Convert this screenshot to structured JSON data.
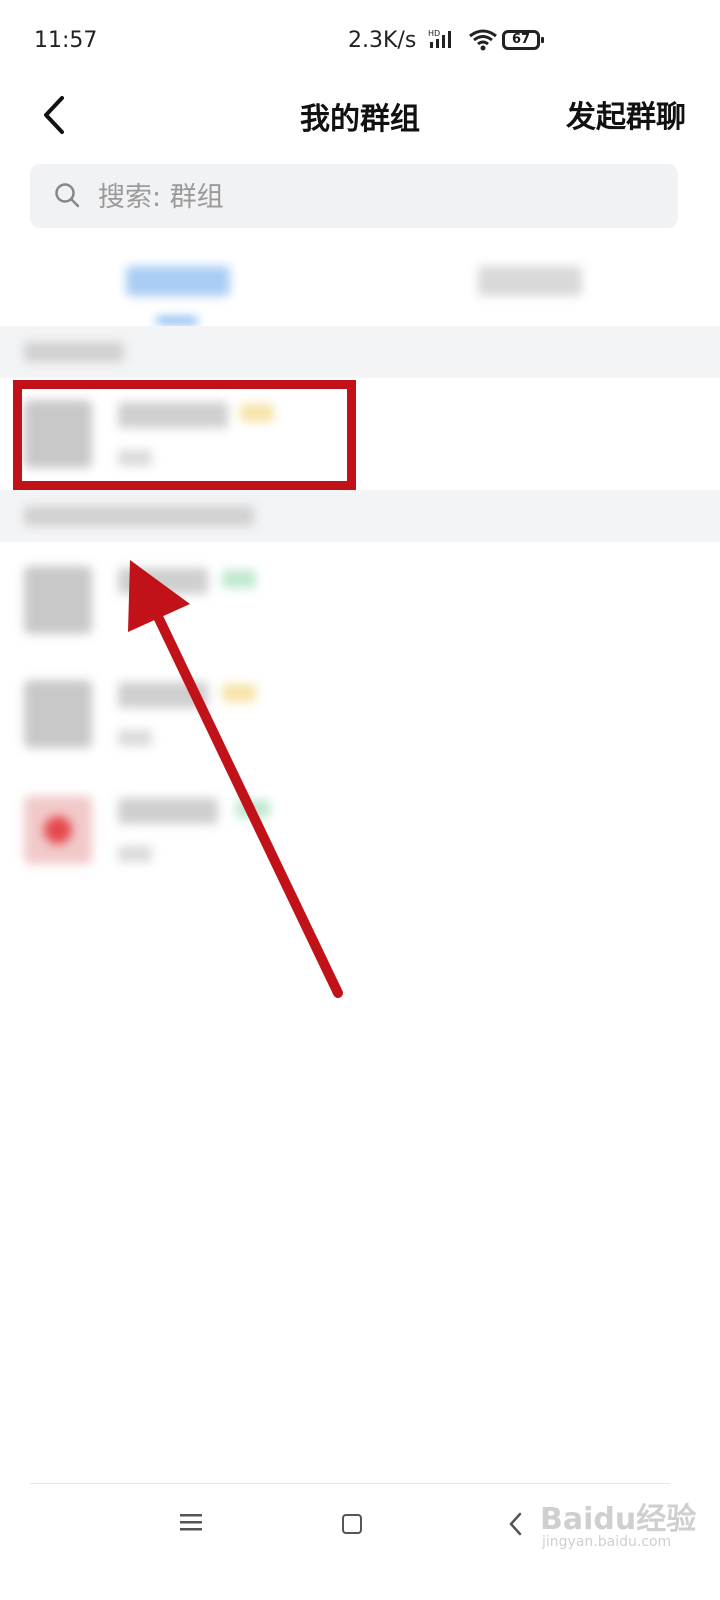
{
  "status": {
    "time": "11:57",
    "speed": "2.3K/s",
    "network_badge": "HD",
    "battery": "67"
  },
  "header": {
    "title": "我的群组",
    "start_chat": "发起群聊",
    "back_icon": "chevron-left-icon"
  },
  "search": {
    "placeholder": "搜索: 群组",
    "icon": "search-icon"
  },
  "annotation": {
    "highlight_color": "#c1121a"
  },
  "navbar": {
    "icons": [
      "menu-icon",
      "home-square-icon",
      "back-chevron-icon"
    ]
  },
  "watermark": {
    "brand": "Baidu经验",
    "url": "jingyan.baidu.com"
  },
  "colors": {
    "accent": "#3a8ee6",
    "annotation_red": "#c1121a"
  }
}
